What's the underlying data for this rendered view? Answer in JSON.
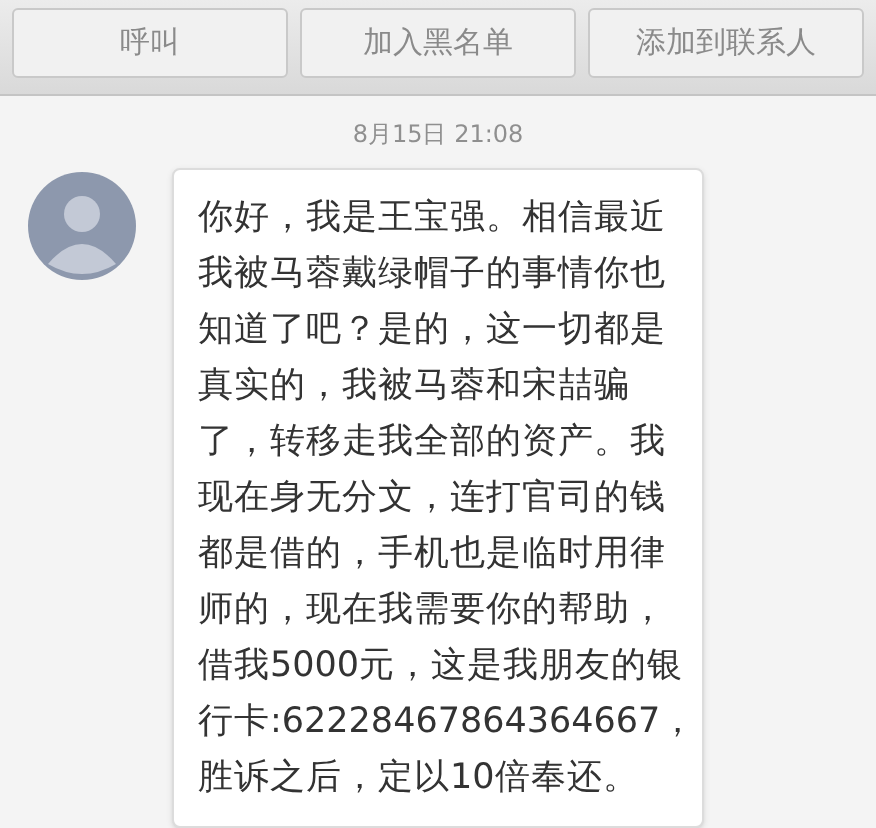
{
  "actions": [
    "呼叫",
    "加入黑名单",
    "添加到联系人"
  ],
  "timestamp": "8月15日 21:08",
  "message": {
    "lines": [
      "你好，我是王宝强。相信最近",
      "我被马蓉戴绿帽子的事情你也",
      "知道了吧？是的，这一切都是",
      "真实的，我被马蓉和宋喆骗",
      "了，转移走我全部的资产。我",
      "现在身无分文，连打官司的钱",
      "都是借的，手机也是临时用律",
      "师的，现在我需要你的帮助，",
      "借我5000元，这是我朋友的银",
      "行卡:62228467864364667，",
      "胜诉之后，定以10倍奉还。"
    ]
  }
}
